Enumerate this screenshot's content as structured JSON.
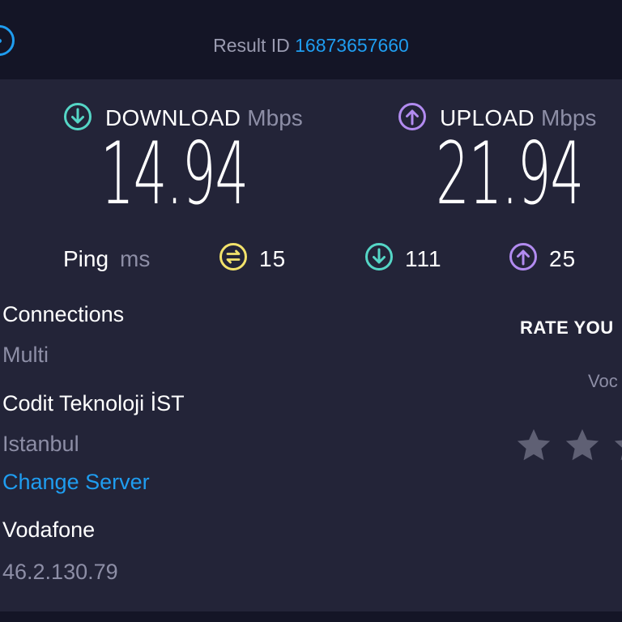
{
  "header": {
    "result_label": "Result ID",
    "result_id": "16873657660"
  },
  "download": {
    "label": "DOWNLOAD",
    "unit": "Mbps",
    "value": "14.94"
  },
  "upload": {
    "label": "UPLOAD",
    "unit": "Mbps",
    "value": "21.94"
  },
  "ping": {
    "label": "Ping",
    "unit": "ms",
    "idle": "15",
    "download": "111",
    "upload": "25"
  },
  "connections": {
    "label": "Connections",
    "value": "Multi"
  },
  "server": {
    "name": "Codit Teknoloji İST",
    "location": "Istanbul",
    "change_label": "Change Server"
  },
  "provider": {
    "name": "Vodafone",
    "ip": "46.2.130.79"
  },
  "rating": {
    "title": "RATE YOU",
    "isp_partial": "Voc"
  },
  "colors": {
    "download_accent": "#55d6c6",
    "upload_accent": "#b28bf0",
    "ping_accent": "#f2e26b",
    "link_blue": "#1f9df0",
    "star_gray": "#5f6074"
  }
}
